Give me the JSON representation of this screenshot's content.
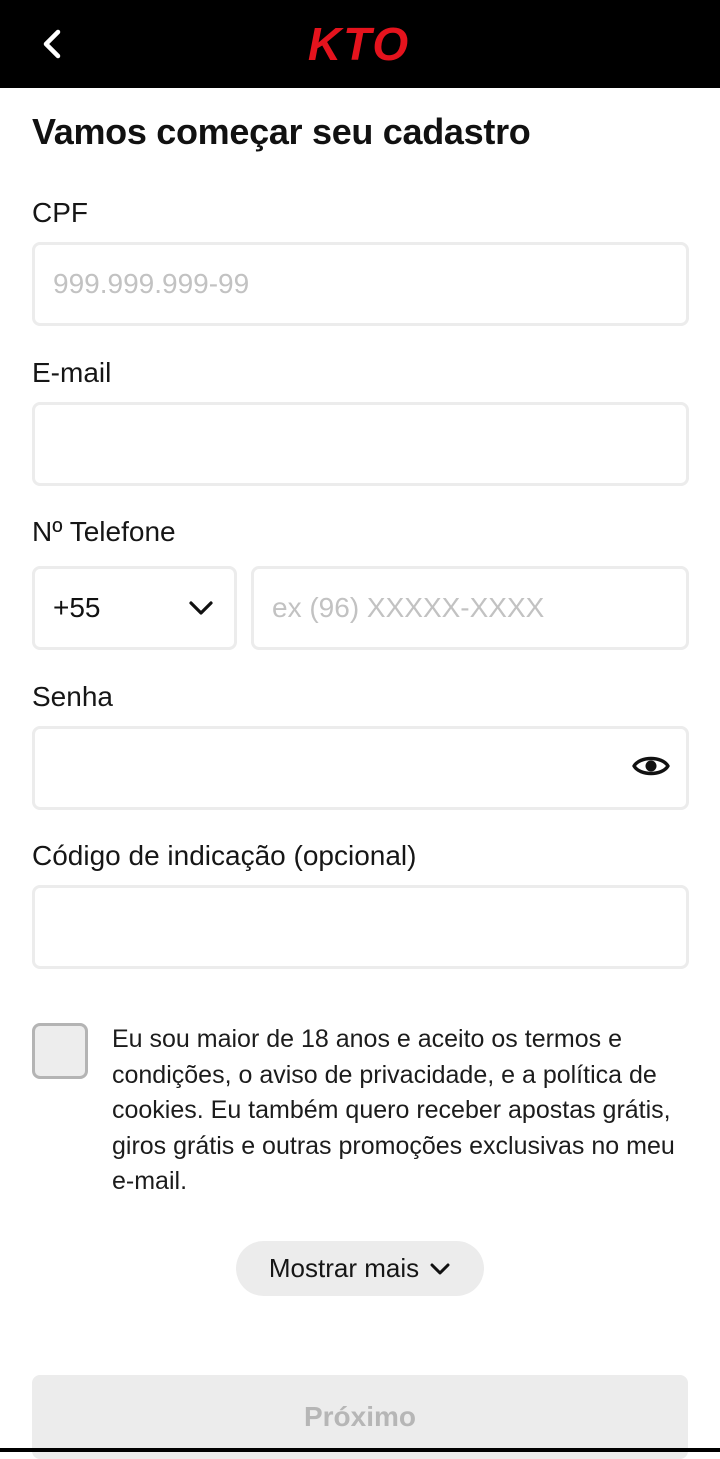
{
  "header": {
    "back_icon": "chevron-left-icon",
    "logo_text": "KTO",
    "logo_color": "#e5131d"
  },
  "form": {
    "title": "Vamos começar seu cadastro",
    "cpf": {
      "label": "CPF",
      "placeholder": "999.999.999-99",
      "value": ""
    },
    "email": {
      "label": "E-mail",
      "placeholder": "",
      "value": ""
    },
    "phone": {
      "label": "Nº Telefone",
      "country_code": "+55",
      "placeholder": "ex (96) XXXXX-XXXX",
      "value": ""
    },
    "password": {
      "label": "Senha",
      "placeholder": "",
      "value": "",
      "toggle_icon": "eye-icon"
    },
    "referral": {
      "label": "Código de indicação (opcional)",
      "placeholder": "",
      "value": ""
    },
    "consent": {
      "checked": false,
      "text": "Eu sou maior de 18 anos e aceito os termos e condições, o aviso de privacidade, e a política de cookies. Eu também quero receber apostas grátis, giros grátis e outras promoções exclusivas no meu e-mail."
    },
    "show_more_label": "Mostrar mais",
    "next_label": "Próximo"
  }
}
